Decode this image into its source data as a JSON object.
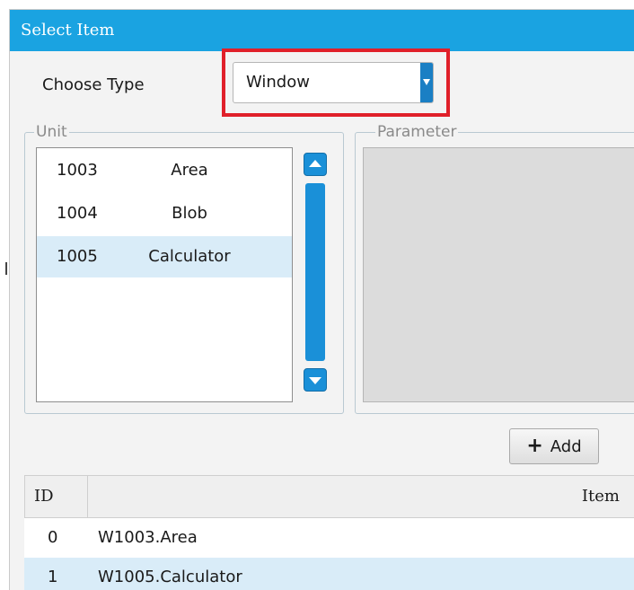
{
  "dialog": {
    "title": "Select Item"
  },
  "choose_type": {
    "label": "Choose Type",
    "value": "Window"
  },
  "unit": {
    "legend": "Unit",
    "items": [
      {
        "code": "1003",
        "name": "Area"
      },
      {
        "code": "1004",
        "name": "Blob"
      },
      {
        "code": "1005",
        "name": "Calculator"
      }
    ]
  },
  "parameter": {
    "legend": "Parameter"
  },
  "add_button": {
    "label": "Add"
  },
  "table": {
    "headers": {
      "id": "ID",
      "item": "Item"
    },
    "rows": [
      {
        "id": "0",
        "item": "W1003.Area"
      },
      {
        "id": "1",
        "item": "W1005.Calculator"
      }
    ]
  },
  "colors": {
    "accent": "#1aa3e1",
    "highlight": "#e0202a",
    "selection": "#d9ecf8"
  },
  "icons": [
    "chevron-down-icon",
    "scroll-up-icon",
    "scroll-down-icon",
    "plus-icon"
  ]
}
